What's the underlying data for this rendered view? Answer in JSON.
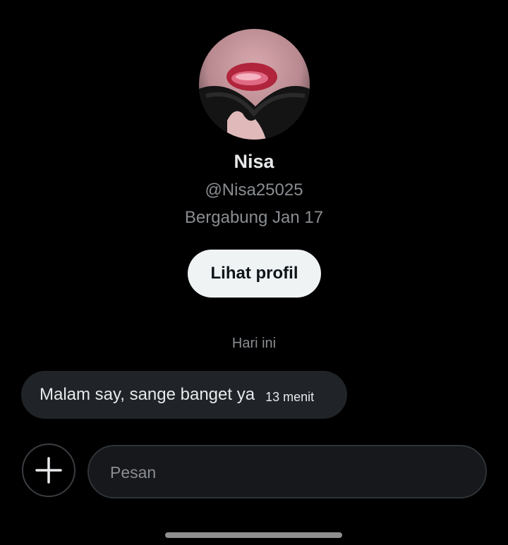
{
  "profile": {
    "name": "Nisa",
    "handle": "@Nisa25025",
    "joined": "Bergabung Jan 17",
    "view_profile_label": "Lihat profil",
    "avatar_icon": "avatar-photo"
  },
  "conversation": {
    "day_separator": "Hari ini",
    "messages": [
      {
        "text": "Malam say, sange banget ya",
        "time": "13 menit"
      }
    ]
  },
  "composer": {
    "add_icon": "plus-icon",
    "placeholder": "Pesan"
  },
  "colors": {
    "background": "#000000",
    "bubble": "#202327",
    "button": "#eff3f4",
    "muted_text": "#8a8d91"
  }
}
